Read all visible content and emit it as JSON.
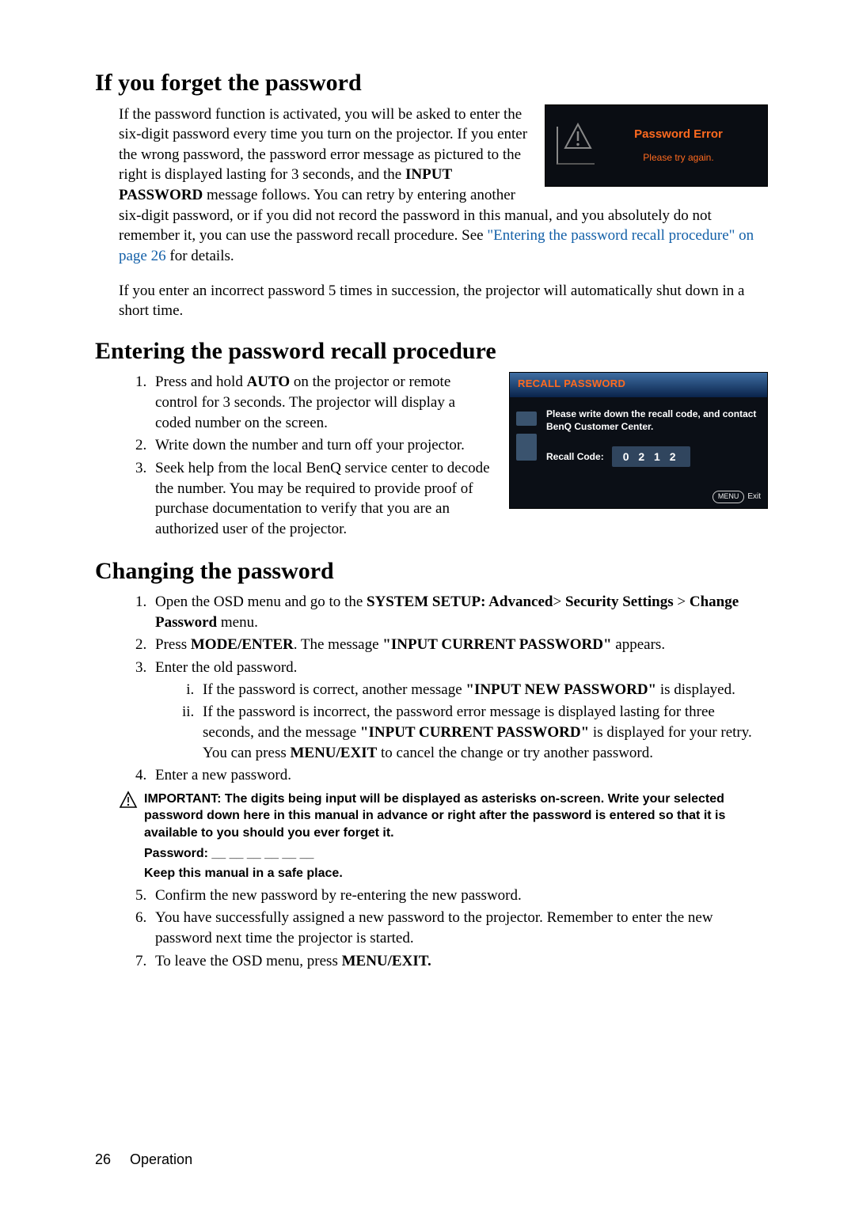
{
  "sec1": {
    "title": "If you forget the password",
    "para_pre": "If the password function is activated, you will be asked to enter the six-digit password every time you turn on the projector. If you enter the wrong password, the password error message as pictured to the right is displayed lasting for 3 seconds, and the ",
    "input_bold": "INPUT PASSWORD",
    "para_mid": " message follows. You can retry by entering another six-digit password, or if you did not record the password in this manual, and you absolutely do not remember it, you can use the password recall procedure. See ",
    "xref": "\"Entering the password recall procedure\" on page 26",
    "para_post": " for details.",
    "para2": "If you enter an incorrect password 5 times in succession, the projector will automatically shut down in a short time."
  },
  "errbox": {
    "title": "Password Error",
    "msg": "Please try again."
  },
  "sec2": {
    "title": "Entering the password recall procedure",
    "step1_pre": "Press and hold ",
    "step1_auto": "AUTO",
    "step1_post": " on the projector or remote control for 3 seconds. The projector will display a coded number on the screen.",
    "step2": "Write down the number and turn off your projector.",
    "step3": "Seek help from the local BenQ service center to decode the number. You may be required to provide proof of purchase documentation to verify that you are an authorized user of the projector."
  },
  "recallbox": {
    "title": "RECALL PASSWORD",
    "msg": "Please write down the recall code, and contact BenQ Customer Center.",
    "code_label": "Recall Code:",
    "code_value": "0 2 1 2",
    "menu": "MENU",
    "exit": "Exit"
  },
  "sec3": {
    "title": "Changing the password",
    "step1_pre": "Open the OSD menu and go to the ",
    "step1_path": "SYSTEM SETUP: Advanced",
    "step1_gt": "> ",
    "step1_sec": "Security Settings",
    "step1_gt2": " > ",
    "step1_chg": "Change Password",
    "step1_post": " menu.",
    "step2_pre": "Press ",
    "step2_mode": "MODE/ENTER",
    "step2_mid": ". The message ",
    "step2_quote": "\"INPUT CURRENT PASSWORD\"",
    "step2_post": " appears.",
    "step3": "Enter the old password.",
    "step3i_pre": "If the password is correct, another message ",
    "step3i_quote": "\"INPUT NEW PASSWORD\"",
    "step3i_post": " is displayed.",
    "step3ii_pre": "If the password is incorrect, the password error message is displayed lasting for three seconds, and the message ",
    "step3ii_quote": "\"INPUT CURRENT PASSWORD\"",
    "step3ii_mid": " is displayed for your retry. You can press ",
    "step3ii_menu": "MENU/EXIT",
    "step3ii_post": " to cancel the change or try another password.",
    "step4": "Enter a new password.",
    "note": "IMPORTANT: The digits being input will be displayed as asterisks on-screen. Write your selected password down here in this manual in advance or right after the password is entered so that it is available to you should you ever forget it.",
    "pwline": "Password: __ __ __ __ __ __",
    "safe": "Keep this manual in a safe place.",
    "step5": "Confirm the new password by re-entering the new password.",
    "step6": "You have successfully assigned a new password to the projector. Remember to enter the new password next time the projector is started.",
    "step7_pre": "To leave the OSD menu, press ",
    "step7_menu": "MENU/EXIT."
  },
  "footer": {
    "pageno": "26",
    "section": "Operation"
  }
}
